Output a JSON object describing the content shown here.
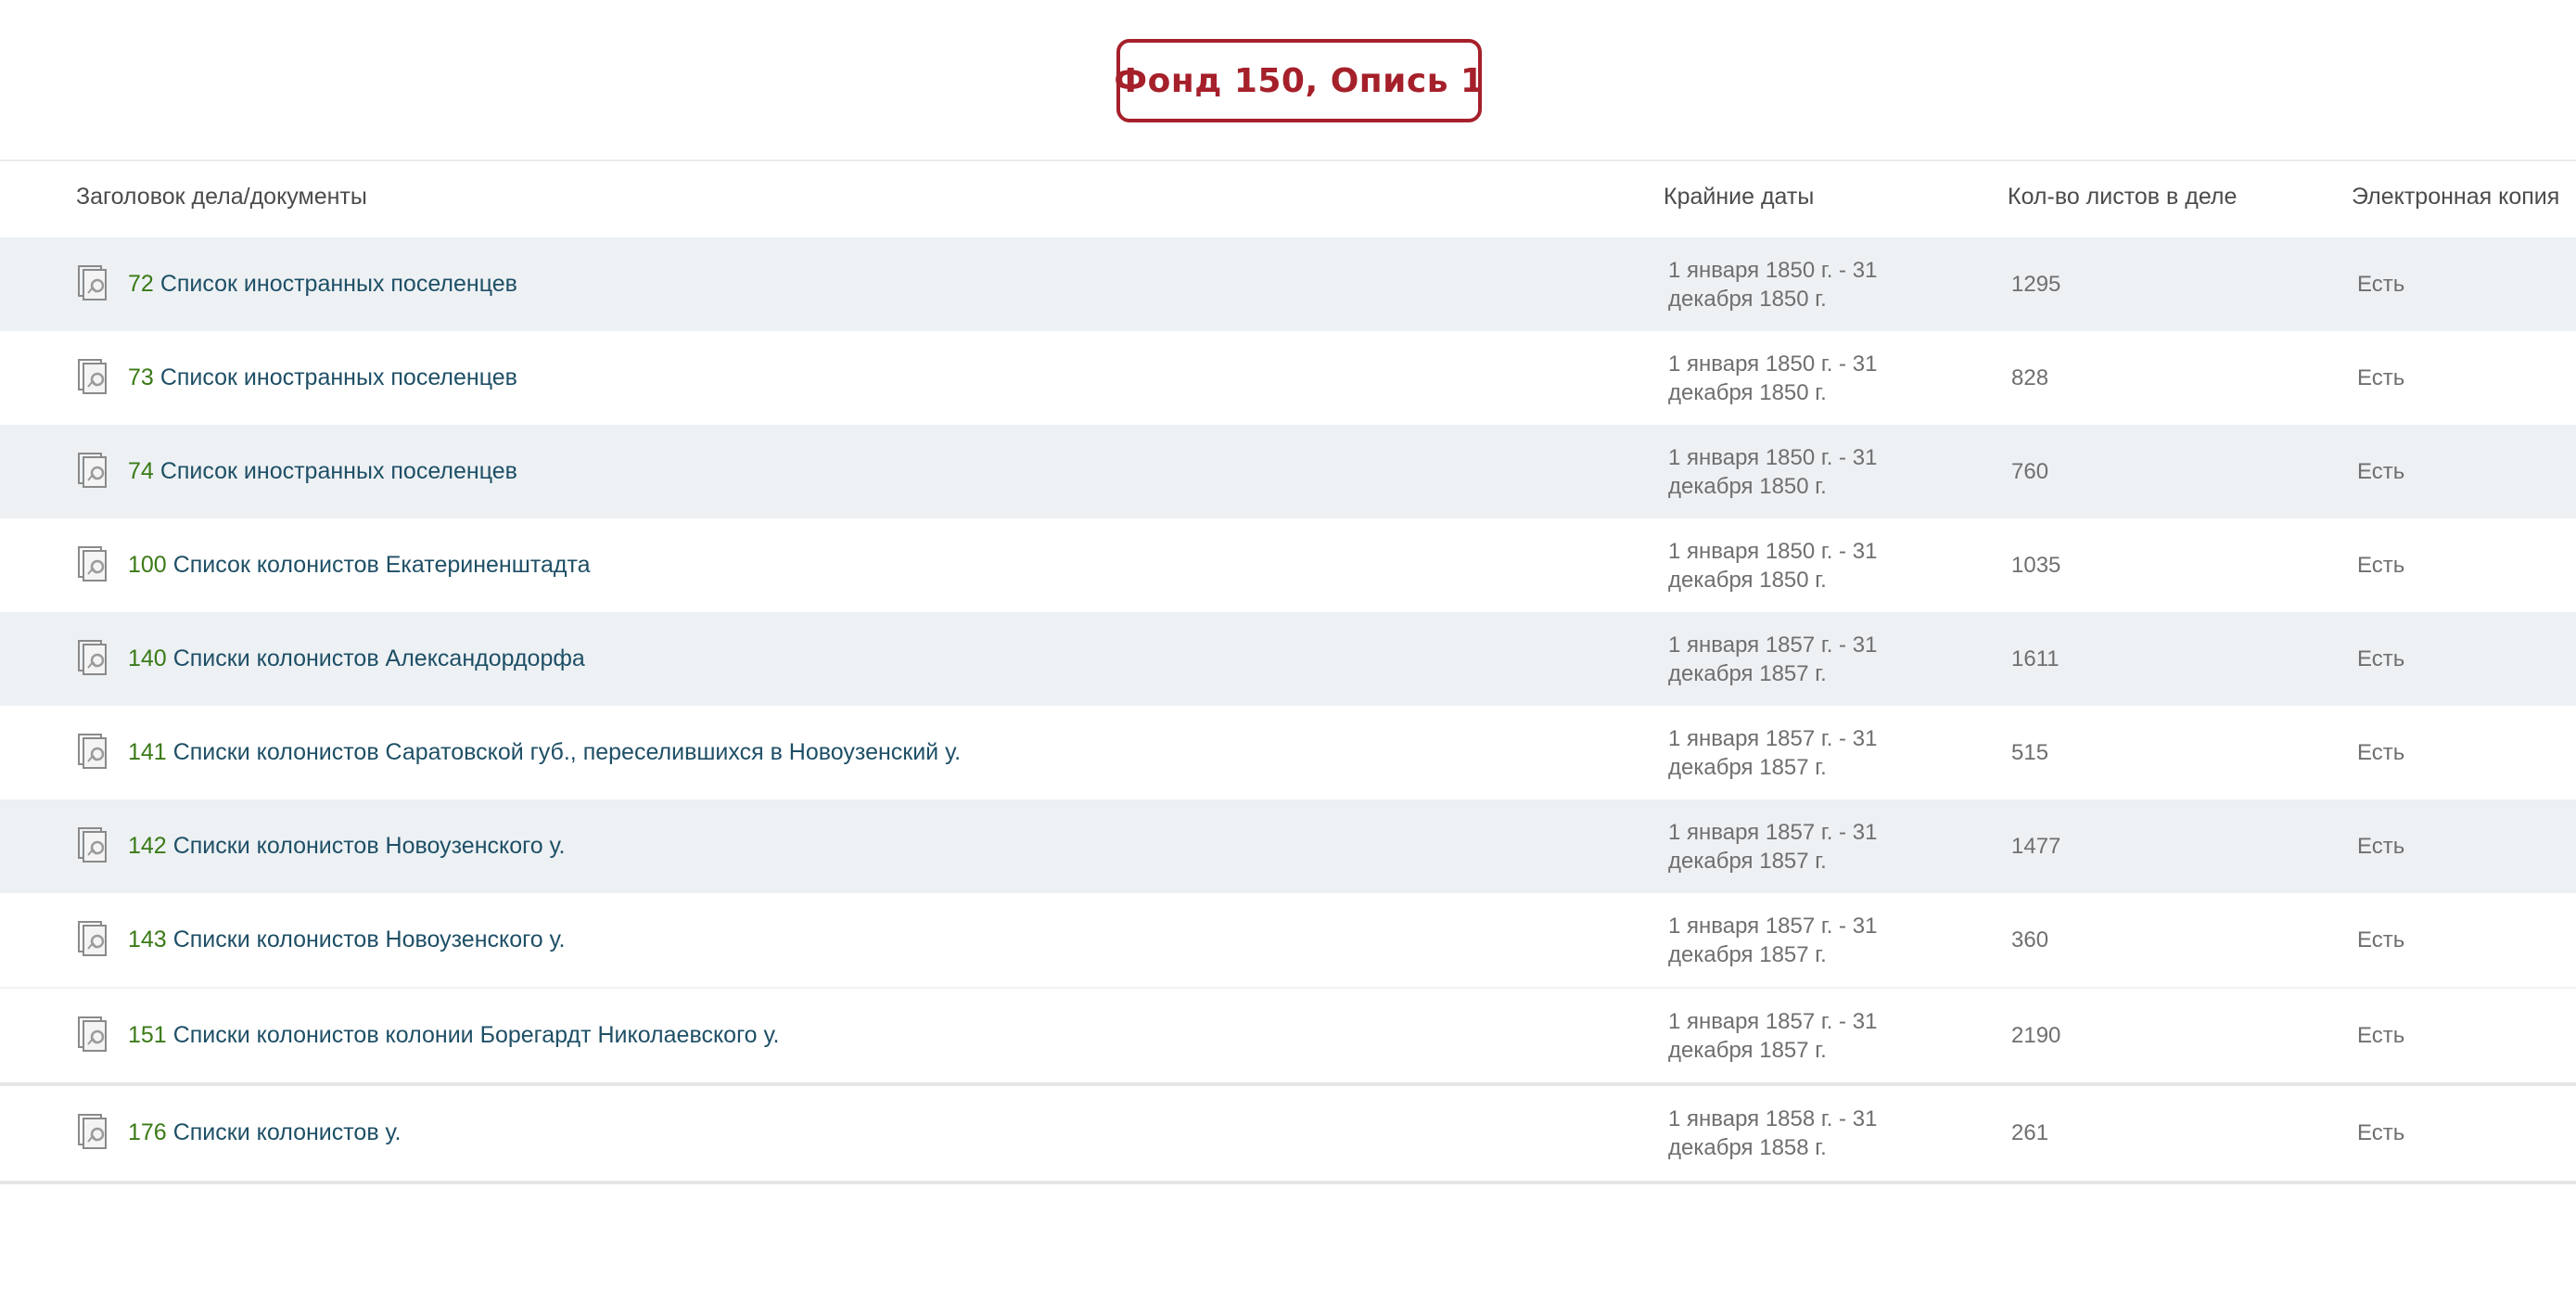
{
  "fond_title": "Фонд 150, Опись 1",
  "columns": {
    "title": "Заголовок дела/документы",
    "dates": "Крайние даты",
    "sheets": "Кол-во листов в деле",
    "copy": "Электронная копия"
  },
  "rows": [
    {
      "num": "72",
      "title": "Список иностранных поселенцев",
      "dates_line1": "1 января 1850 г. - 31",
      "dates_line2": "декабря 1850 г.",
      "sheets": "1295",
      "copy": "Есть"
    },
    {
      "num": "73",
      "title": "Список иностранных поселенцев",
      "dates_line1": "1 января 1850 г. - 31",
      "dates_line2": "декабря 1850 г.",
      "sheets": "828",
      "copy": "Есть"
    },
    {
      "num": "74",
      "title": "Список иностранных поселенцев",
      "dates_line1": "1 января 1850 г. - 31",
      "dates_line2": "декабря 1850 г.",
      "sheets": "760",
      "copy": "Есть"
    },
    {
      "num": "100",
      "title": "Список колонистов Екатериненштадта",
      "dates_line1": "1 января 1850 г. - 31",
      "dates_line2": "декабря 1850 г.",
      "sheets": "1035",
      "copy": "Есть"
    },
    {
      "num": "140",
      "title": "Списки колонистов Александордорфа",
      "dates_line1": "1 января 1857 г. - 31",
      "dates_line2": "декабря 1857 г.",
      "sheets": "1611",
      "copy": "Есть"
    },
    {
      "num": "141",
      "title": "Списки колонистов Саратовской губ., переселившихся в Новоузенский у.",
      "dates_line1": "1 января 1857 г. - 31",
      "dates_line2": "декабря 1857 г.",
      "sheets": "515",
      "copy": "Есть"
    },
    {
      "num": "142",
      "title": "Списки колонистов Новоузенского у.",
      "dates_line1": "1 января 1857 г. - 31",
      "dates_line2": "декабря 1857 г.",
      "sheets": "1477",
      "copy": "Есть"
    },
    {
      "num": "143",
      "title": "Списки колонистов Новоузенского у.",
      "dates_line1": "1 января 1857 г. - 31",
      "dates_line2": "декабря 1857 г.",
      "sheets": "360",
      "copy": "Есть"
    },
    {
      "num": "151",
      "title": "Списки колонистов колонии Борегардт Николаевского у.",
      "dates_line1": "1 января 1857 г. - 31",
      "dates_line2": "декабря 1857 г.",
      "sheets": "2190",
      "copy": "Есть"
    },
    {
      "num": "176",
      "title": "Списки колонистов у.",
      "dates_line1": "1 января 1858 г. - 31",
      "dates_line2": "декабря 1858 г.",
      "sheets": "261",
      "copy": "Есть"
    }
  ],
  "colors": {
    "badge": "#a5202a",
    "doc_number": "#3a7a16",
    "doc_title": "#1e4f66",
    "row_shade": "#edf1f4"
  },
  "icons": {
    "row_icon": "document-image-icon"
  }
}
